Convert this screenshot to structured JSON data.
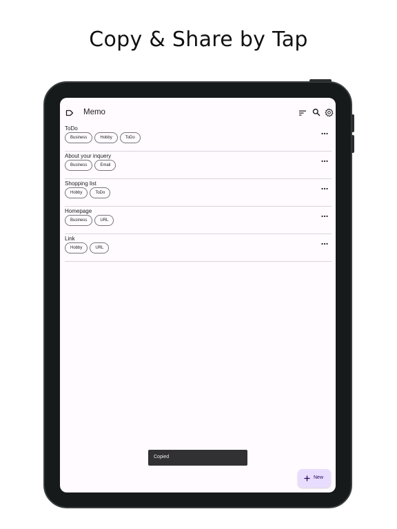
{
  "headline": "Copy & Share by Tap",
  "appbar": {
    "title": "Memo",
    "icons": [
      "label-icon",
      "sort-icon",
      "search-icon",
      "gear-icon"
    ]
  },
  "memos": [
    {
      "title": "ToDo",
      "tags": [
        "Business",
        "Hobby",
        "ToDo"
      ]
    },
    {
      "title": "About your inquery",
      "tags": [
        "Business",
        "Email"
      ]
    },
    {
      "title": "Shopping list",
      "tags": [
        "Hobby",
        "ToDo"
      ]
    },
    {
      "title": "Homepage",
      "tags": [
        "Business",
        "URL"
      ]
    },
    {
      "title": "Link",
      "tags": [
        "Hobby",
        "URL"
      ]
    }
  ],
  "snackbar": {
    "text": "Copied"
  },
  "fab": {
    "label": "New",
    "icon": "plus-icon"
  },
  "colors": {
    "screen_background": "#fffbff",
    "device_frame": "#161a1b",
    "fab_background": "#e9ddff",
    "snackbar_background": "#313033"
  }
}
